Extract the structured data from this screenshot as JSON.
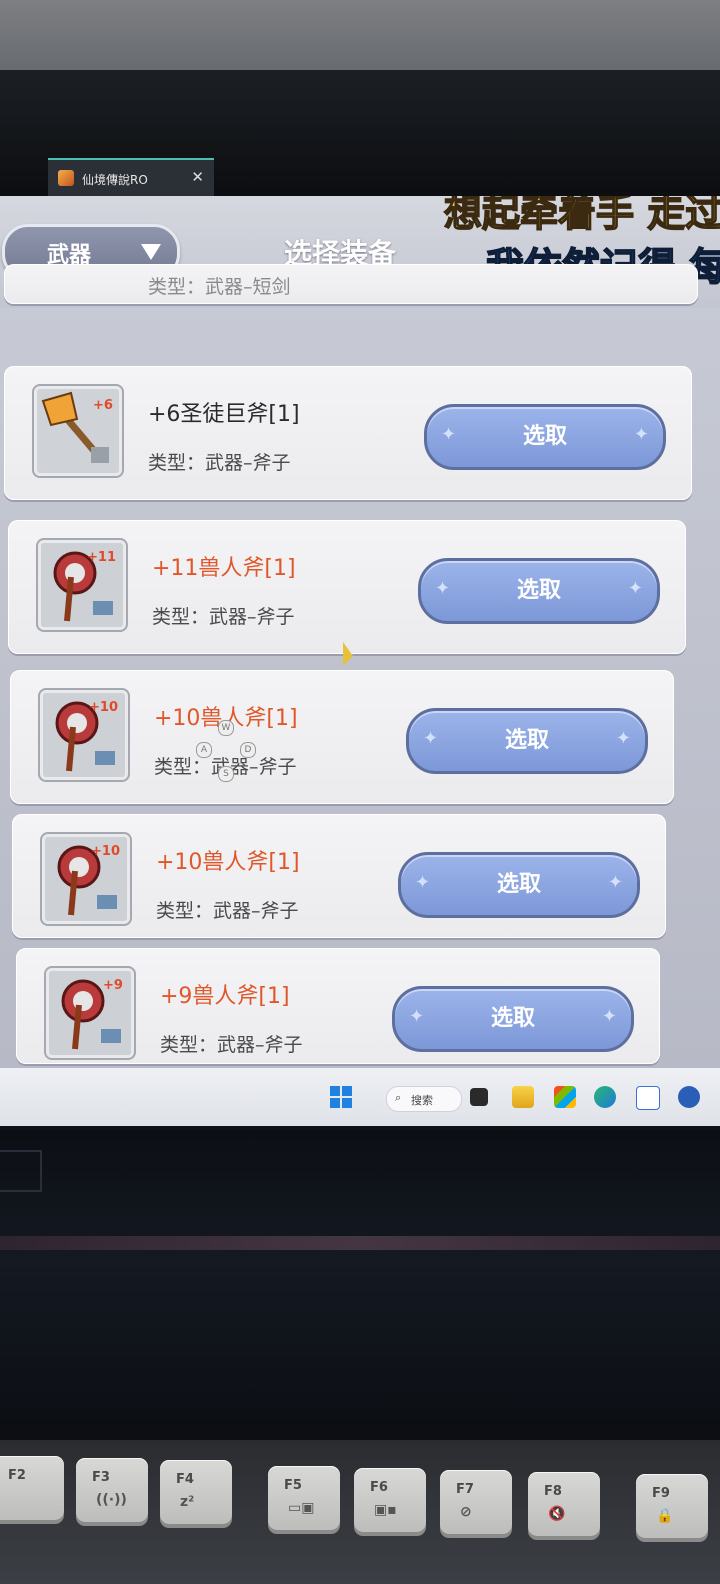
{
  "window_tab": {
    "title": "仙境傳說RO",
    "close": "✕"
  },
  "header": {
    "category_select": {
      "label": "武器"
    },
    "title": "选择装备",
    "lyrics": {
      "line1": "想起牵着手 走过",
      "line2": "我依然记得 每"
    }
  },
  "list": {
    "items": [
      {
        "name": "",
        "type": "类型：武器–短剑",
        "button": "",
        "partial": true
      },
      {
        "name": "+6圣徒巨斧[1]",
        "type": "类型：武器–斧子",
        "button": "选取",
        "refine_badge": "+6",
        "name_color": "#2b2b2b"
      },
      {
        "name": "+11兽人斧[1]",
        "type": "类型：武器–斧子",
        "button": "选取",
        "refine_badge": "+11",
        "name_color": "#e0572a"
      },
      {
        "name": "+10兽人斧[1]",
        "type": "类型：武器–斧子",
        "button": "选取",
        "refine_badge": "+10",
        "name_color": "#e0572a"
      },
      {
        "name": "+10兽人斧[1]",
        "type": "类型：武器–斧子",
        "button": "选取",
        "refine_badge": "+10",
        "name_color": "#e0572a"
      },
      {
        "name": "+9兽人斧[1]",
        "type": "类型：武器–斧子",
        "button": "选取",
        "refine_badge": "+9",
        "name_color": "#e0572a"
      }
    ]
  },
  "overlay_keys": [
    "W",
    "A",
    "S",
    "D"
  ],
  "taskbar": {
    "search_label": "搜索",
    "apps": [
      "start-icon",
      "search-icon",
      "task-view-icon",
      "file-explorer-icon",
      "store-icon",
      "edge-icon",
      "baidu-icon",
      "app-icon"
    ]
  },
  "keyboard": {
    "keys": [
      {
        "label": "F2",
        "sub": ""
      },
      {
        "label": "F3",
        "sub": "((·))"
      },
      {
        "label": "F4",
        "sub": "z²"
      },
      {
        "label": "F5",
        "sub": "▭▣"
      },
      {
        "label": "F6",
        "sub": "▣▪"
      },
      {
        "label": "F7",
        "sub": "⊘"
      },
      {
        "label": "F8",
        "sub": "🔇"
      },
      {
        "label": "F9",
        "sub": "🔒"
      }
    ]
  }
}
